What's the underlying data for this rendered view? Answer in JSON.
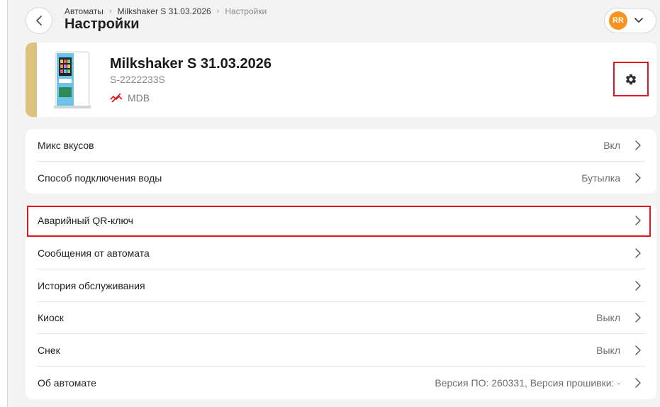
{
  "header": {
    "breadcrumb": [
      "Автоматы",
      "Milkshaker S 31.03.2026",
      "Настройки"
    ],
    "title": "Настройки",
    "user_initials": "RR",
    "avatar_color": "#f7931e"
  },
  "device": {
    "name": "Milkshaker S 31.03.2026",
    "serial": "S-2222233S",
    "payment": "MDB",
    "accent_color": "#dcc27e"
  },
  "settings_group_1": [
    {
      "label": "Микс вкусов",
      "value": "Вкл"
    },
    {
      "label": "Способ подключения воды",
      "value": "Бутылка"
    }
  ],
  "settings_group_2": [
    {
      "label": "Аварийный QR-ключ",
      "value": ""
    },
    {
      "label": "Сообщения от автомата",
      "value": ""
    },
    {
      "label": "История обслуживания",
      "value": ""
    },
    {
      "label": "Киоск",
      "value": "Выкл"
    },
    {
      "label": "Снек",
      "value": "Выкл"
    },
    {
      "label": "Об автомате",
      "value": "Версия ПО: 260331, Версия прошивки: -"
    }
  ],
  "highlight_color": "#e0141e"
}
